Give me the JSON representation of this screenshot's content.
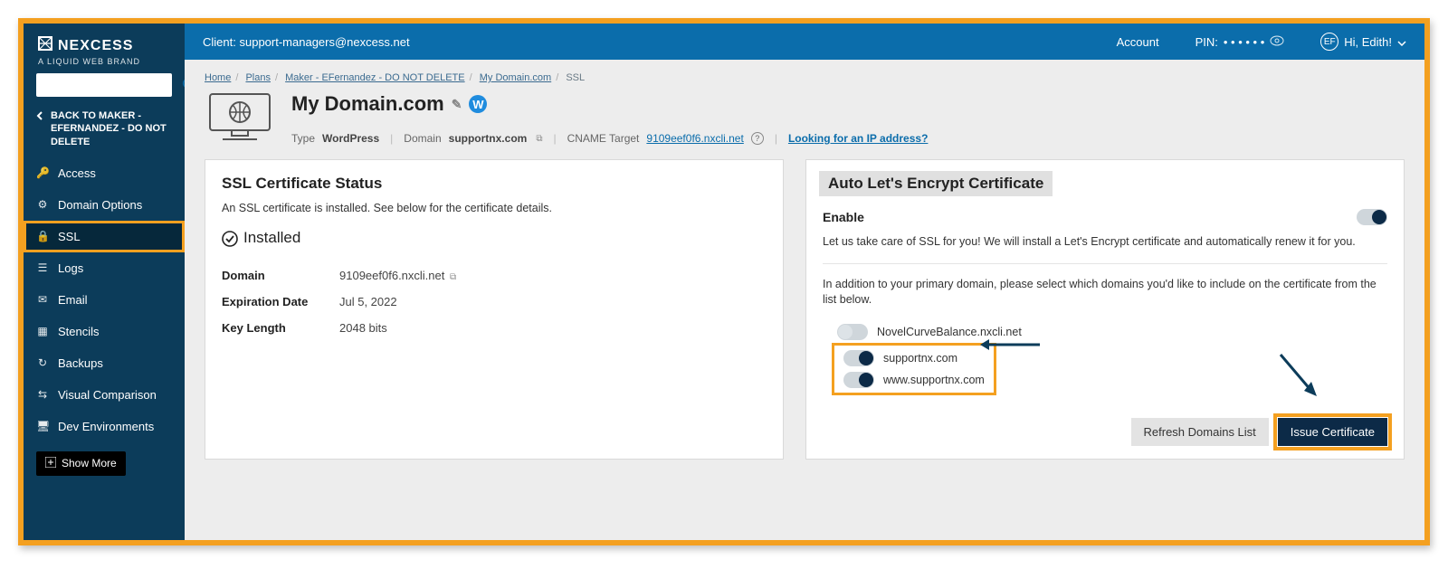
{
  "brand": {
    "name": "NEXCESS",
    "tagline": "A LIQUID WEB BRAND"
  },
  "search": {
    "placeholder": ""
  },
  "back": {
    "label": "BACK TO MAKER - EFERNANDEZ - DO NOT DELETE"
  },
  "sidebar": {
    "items": [
      {
        "icon": "key-icon",
        "label": "Access"
      },
      {
        "icon": "gear-icon",
        "label": "Domain Options"
      },
      {
        "icon": "lock-icon",
        "label": "SSL"
      },
      {
        "icon": "list-icon",
        "label": "Logs"
      },
      {
        "icon": "mail-icon",
        "label": "Email"
      },
      {
        "icon": "grid-icon",
        "label": "Stencils"
      },
      {
        "icon": "clock-icon",
        "label": "Backups"
      },
      {
        "icon": "compare-icon",
        "label": "Visual Comparison"
      },
      {
        "icon": "monitor-icon",
        "label": "Dev Environments"
      }
    ],
    "showMore": "Show More"
  },
  "topbar": {
    "client_label": "Client:",
    "client_value": "support-managers@nexcess.net",
    "account": "Account",
    "pin_label": "PIN:",
    "pin_mask": "• • • • • •",
    "user_initials": "EF",
    "greeting": "Hi, Edith!"
  },
  "breadcrumbs": {
    "items": [
      "Home",
      "Plans",
      "Maker - EFernandez - DO NOT DELETE",
      "My Domain.com"
    ],
    "current": "SSL"
  },
  "page": {
    "title": "My Domain.com",
    "meta": {
      "type_label": "Type",
      "type_value": "WordPress",
      "domain_label": "Domain",
      "domain_value": "supportnx.com",
      "cname_label": "CNAME Target",
      "cname_value": "9109eef0f6.nxcli.net",
      "ip_link": "Looking for an IP address?"
    }
  },
  "ssl_panel": {
    "title": "SSL Certificate Status",
    "sub": "An SSL certificate is installed. See below for the certificate details.",
    "status": "Installed",
    "domain_label": "Domain",
    "domain_value": "9109eef0f6.nxcli.net",
    "exp_label": "Expiration Date",
    "exp_value": "Jul 5, 2022",
    "keylen_label": "Key Length",
    "keylen_value": "2048 bits"
  },
  "le_panel": {
    "title": "Auto Let's Encrypt Certificate",
    "enable_label": "Enable",
    "para1": "Let us take care of SSL for you! We will install a Let's Encrypt certificate and automatically renew it for you.",
    "para2": "In addition to your primary domain, please select which domains you'd like to include on the certificate from the list below.",
    "domains": [
      {
        "name": "NovelCurveBalance.nxcli.net",
        "on": false
      },
      {
        "name": "supportnx.com",
        "on": true
      },
      {
        "name": "www.supportnx.com",
        "on": true
      }
    ],
    "refresh": "Refresh Domains List",
    "issue": "Issue Certificate"
  }
}
